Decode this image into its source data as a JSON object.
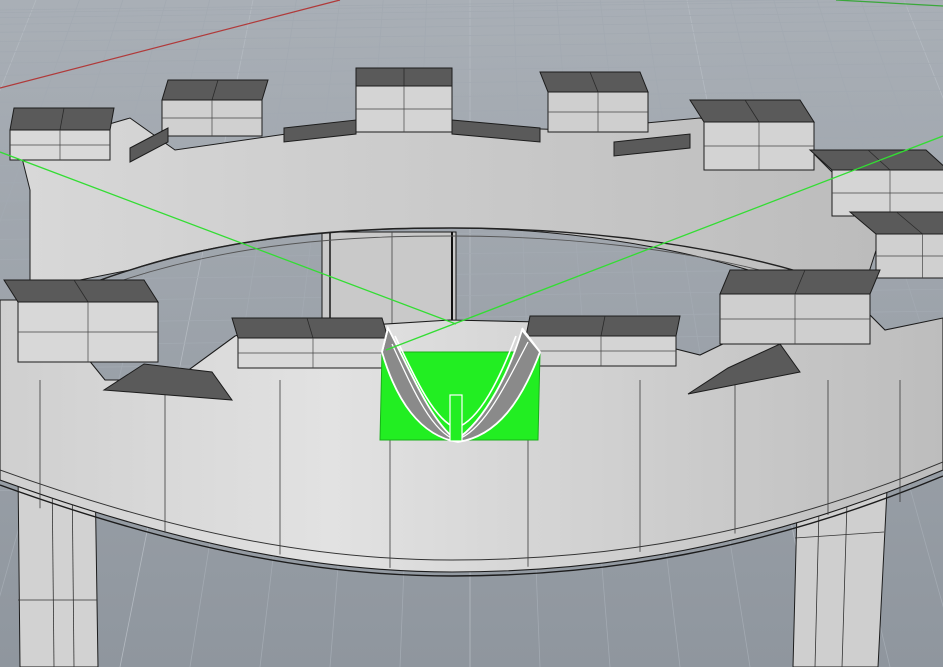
{
  "viewport": {
    "view_name": "",
    "background_top": "#a9afb6",
    "background_bottom": "#8f969e",
    "grid_minor_color": "#a3aab2",
    "grid_major_color": "#b4bac1"
  },
  "axes": {
    "x_axis_color": "#b03a3a",
    "y_axis_color": "#3aa83a"
  },
  "model": {
    "object": "castle-tower-crown",
    "surface_color": "#d6d6d6",
    "surface_shadow_color": "#b8b8b8",
    "top_face_color": "#5a5a5a",
    "edge_color": "#1c1c1c",
    "merlon_count": 12
  },
  "selection": {
    "highlight_color": "#22ee22",
    "selected_edge_color": "#ffffff",
    "guide_line_color": "#33dd33"
  },
  "icons": {
    "world-x-axis": "world-x-axis-icon",
    "world-y-axis": "world-y-axis-icon"
  }
}
